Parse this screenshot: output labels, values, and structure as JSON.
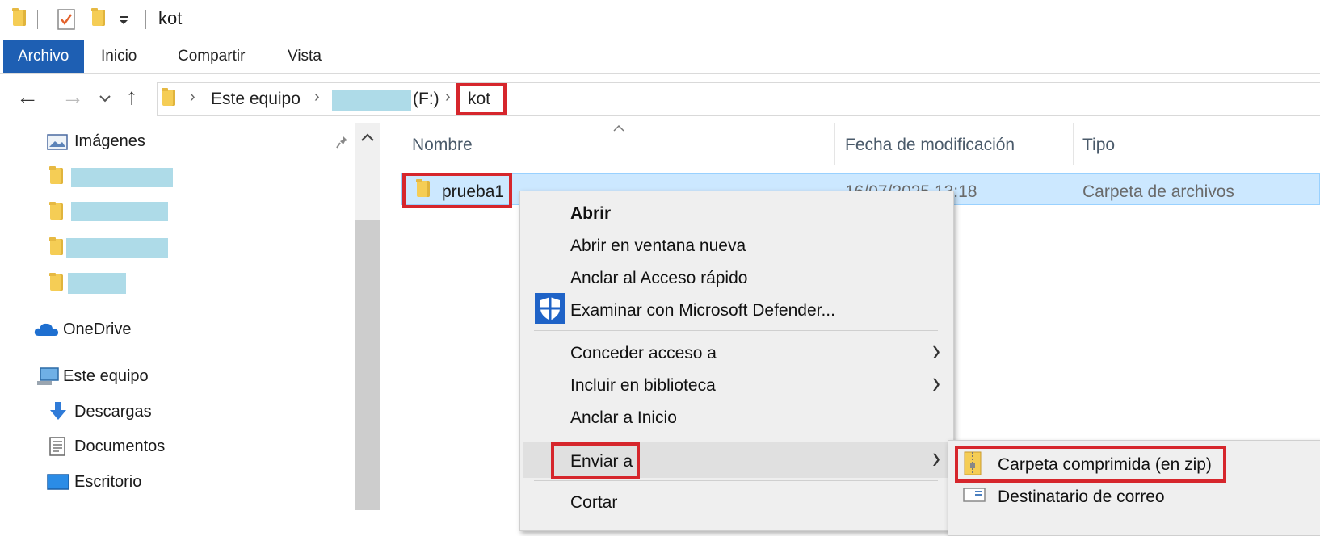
{
  "window": {
    "title": "kot"
  },
  "ribbon": {
    "tabs": [
      "Archivo",
      "Inicio",
      "Compartir",
      "Vista"
    ]
  },
  "address": {
    "crumbs": [
      "Este equipo",
      "(F:)",
      "kot"
    ]
  },
  "nav": {
    "quick_access": "Imágenes",
    "onedrive": "OneDrive",
    "this_pc": "Este equipo",
    "downloads": "Descargas",
    "documents": "Documentos",
    "desktop": "Escritorio"
  },
  "files": {
    "columns": [
      "Nombre",
      "Fecha de modificación",
      "Tipo"
    ],
    "rows": [
      {
        "name": "prueba1",
        "date": "16/07/2025 13:18",
        "type": "Carpeta de archivos"
      }
    ]
  },
  "context_menu": {
    "items": [
      "Abrir",
      "Abrir en ventana nueva",
      "Anclar al Acceso rápido",
      "Examinar con Microsoft Defender...",
      "Conceder acceso a",
      "Incluir en biblioteca",
      "Anclar a Inicio",
      "Enviar a",
      "Cortar"
    ]
  },
  "submenu": {
    "items": [
      "Carpeta comprimida (en zip)",
      "Destinatario de correo"
    ]
  },
  "colors": {
    "accent": "#1e5fb3",
    "highlight": "#d6262c",
    "selection": "#cce8ff"
  },
  "icons": [
    "folder-icon",
    "checklist-icon",
    "dropdown-icon",
    "pin-icon",
    "pictures-icon",
    "onedrive-icon",
    "this-pc-icon",
    "download-icon",
    "documents-icon",
    "desktop-icon",
    "defender-shield-icon",
    "zip-folder-icon",
    "mail-recipient-icon"
  ]
}
